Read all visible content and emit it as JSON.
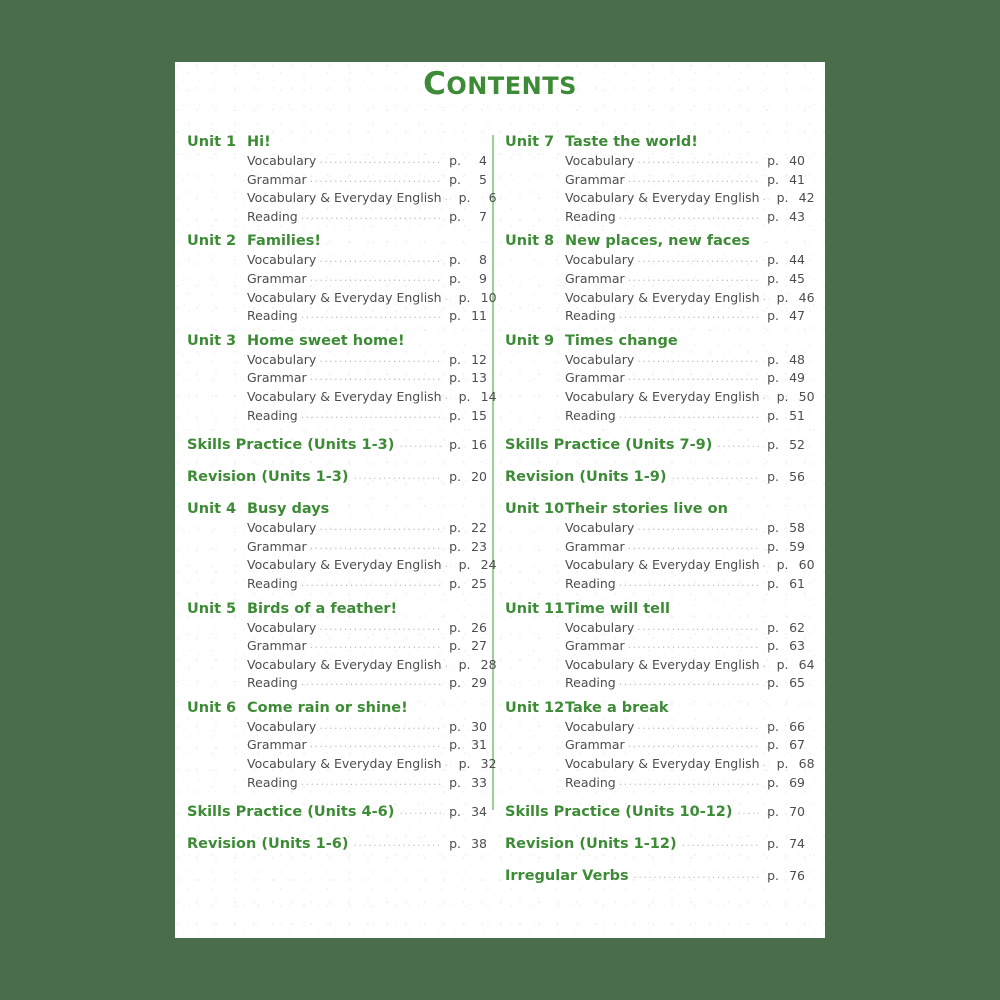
{
  "page": {
    "title_first": "C",
    "title_rest": "ONTENTS",
    "title_full": "CONTENTS",
    "page_marker": "p.",
    "leader_dots": "......................................................................................................",
    "colors": {
      "background": "#4a6e4c",
      "sheet": "#ffffff",
      "green": "#3d8b36",
      "divider": "#9fcf98",
      "subtext": "#4d4d4d",
      "leader": "#bdbdbd"
    },
    "sub_labels": {
      "vocabulary": "Vocabulary",
      "grammar": "Grammar",
      "vocab_everyday": "Vocabulary & Everyday English",
      "reading": "Reading"
    }
  },
  "columns": {
    "left": [
      {
        "kind": "unit",
        "unit": "Unit 1",
        "title": "Hi!",
        "rows": [
          {
            "label": "Vocabulary",
            "page": "4"
          },
          {
            "label": "Grammar",
            "page": "5"
          },
          {
            "label": "Vocabulary & Everyday English",
            "page": "6"
          },
          {
            "label": "Reading",
            "page": "7"
          }
        ]
      },
      {
        "kind": "unit",
        "unit": "Unit 2",
        "title": "Families!",
        "rows": [
          {
            "label": "Vocabulary",
            "page": "8"
          },
          {
            "label": "Grammar",
            "page": "9"
          },
          {
            "label": "Vocabulary & Everyday English",
            "page": "10"
          },
          {
            "label": "Reading",
            "page": "11"
          }
        ]
      },
      {
        "kind": "unit",
        "unit": "Unit 3",
        "title": "Home sweet home!",
        "rows": [
          {
            "label": "Vocabulary",
            "page": "12"
          },
          {
            "label": "Grammar",
            "page": "13"
          },
          {
            "label": "Vocabulary & Everyday English",
            "page": "14"
          },
          {
            "label": "Reading",
            "page": "15"
          }
        ]
      },
      {
        "kind": "special",
        "label": "Skills Practice (Units 1-3)",
        "page": "16"
      },
      {
        "kind": "special",
        "label": "Revision (Units 1-3)",
        "page": "20"
      },
      {
        "kind": "unit",
        "unit": "Unit 4",
        "title": "Busy days",
        "rows": [
          {
            "label": "Vocabulary",
            "page": "22"
          },
          {
            "label": "Grammar",
            "page": "23"
          },
          {
            "label": "Vocabulary & Everyday English",
            "page": "24"
          },
          {
            "label": "Reading",
            "page": "25"
          }
        ]
      },
      {
        "kind": "unit",
        "unit": "Unit 5",
        "title": "Birds of a feather!",
        "rows": [
          {
            "label": "Vocabulary",
            "page": "26"
          },
          {
            "label": "Grammar",
            "page": "27"
          },
          {
            "label": "Vocabulary & Everyday English",
            "page": "28"
          },
          {
            "label": "Reading",
            "page": "29"
          }
        ]
      },
      {
        "kind": "unit",
        "unit": "Unit 6",
        "title": "Come rain or shine!",
        "rows": [
          {
            "label": "Vocabulary",
            "page": "30"
          },
          {
            "label": "Grammar",
            "page": "31"
          },
          {
            "label": "Vocabulary & Everyday English",
            "page": "32"
          },
          {
            "label": "Reading",
            "page": "33"
          }
        ]
      },
      {
        "kind": "special",
        "label": "Skills Practice (Units 4-6)",
        "page": "34"
      },
      {
        "kind": "special",
        "label": "Revision (Units 1-6)",
        "page": "38"
      }
    ],
    "right": [
      {
        "kind": "unit",
        "unit": "Unit 7",
        "title": "Taste the world!",
        "rows": [
          {
            "label": "Vocabulary",
            "page": "40"
          },
          {
            "label": "Grammar",
            "page": "41"
          },
          {
            "label": "Vocabulary & Everyday English",
            "page": "42"
          },
          {
            "label": "Reading",
            "page": "43"
          }
        ]
      },
      {
        "kind": "unit",
        "unit": "Unit 8",
        "title": "New places, new faces",
        "rows": [
          {
            "label": "Vocabulary",
            "page": "44"
          },
          {
            "label": "Grammar",
            "page": "45"
          },
          {
            "label": "Vocabulary & Everyday English",
            "page": "46"
          },
          {
            "label": "Reading",
            "page": "47"
          }
        ]
      },
      {
        "kind": "unit",
        "unit": "Unit 9",
        "title": "Times change",
        "rows": [
          {
            "label": "Vocabulary",
            "page": "48"
          },
          {
            "label": "Grammar",
            "page": "49"
          },
          {
            "label": "Vocabulary & Everyday English",
            "page": "50"
          },
          {
            "label": "Reading",
            "page": "51"
          }
        ]
      },
      {
        "kind": "special",
        "label": "Skills Practice (Units 7-9)",
        "page": "52"
      },
      {
        "kind": "special",
        "label": "Revision (Units 1-9)",
        "page": "56"
      },
      {
        "kind": "unit",
        "unit": "Unit 10",
        "title": "Their stories live on",
        "rows": [
          {
            "label": "Vocabulary",
            "page": "58"
          },
          {
            "label": "Grammar",
            "page": "59"
          },
          {
            "label": "Vocabulary & Everyday English",
            "page": "60"
          },
          {
            "label": "Reading",
            "page": "61"
          }
        ]
      },
      {
        "kind": "unit",
        "unit": "Unit 11",
        "title": "Time will tell",
        "rows": [
          {
            "label": "Vocabulary",
            "page": "62"
          },
          {
            "label": "Grammar",
            "page": "63"
          },
          {
            "label": "Vocabulary & Everyday English",
            "page": "64"
          },
          {
            "label": "Reading",
            "page": "65"
          }
        ]
      },
      {
        "kind": "unit",
        "unit": "Unit 12",
        "title": "Take a break",
        "rows": [
          {
            "label": "Vocabulary",
            "page": "66"
          },
          {
            "label": "Grammar",
            "page": "67"
          },
          {
            "label": "Vocabulary & Everyday English",
            "page": "68"
          },
          {
            "label": "Reading",
            "page": "69"
          }
        ]
      },
      {
        "kind": "special",
        "label": "Skills Practice (Units 10-12)",
        "page": "70"
      },
      {
        "kind": "special",
        "label": "Revision (Units 1-12)",
        "page": "74"
      },
      {
        "kind": "special",
        "label": "Irregular Verbs",
        "page": "76"
      }
    ]
  }
}
